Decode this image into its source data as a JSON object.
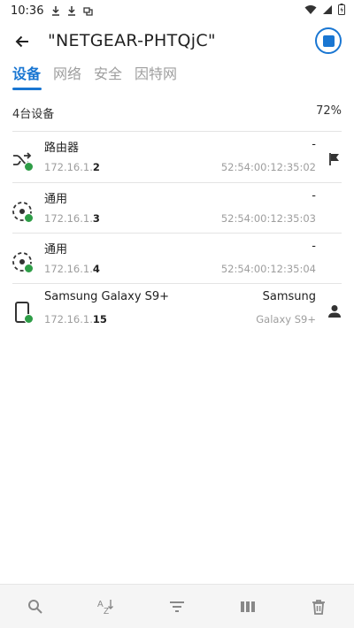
{
  "status_bar": {
    "time": "10:36"
  },
  "app_bar": {
    "title": "\"NETGEAR-PHTQjC\""
  },
  "tabs": [
    {
      "label": "设备",
      "active": true
    },
    {
      "label": "网络",
      "active": false
    },
    {
      "label": "安全",
      "active": false
    },
    {
      "label": "因特网",
      "active": false
    }
  ],
  "summary": {
    "count": "4台设备",
    "percent": "72%"
  },
  "devices": [
    {
      "name": "路由器",
      "ip_prefix": "172.16.1.",
      "ip_suffix": "2",
      "vendor": "-",
      "mac": "52:54:00:12:35:02",
      "icon": "router-shuffle-icon",
      "trailing_icon": "flag-icon"
    },
    {
      "name": "通用",
      "ip_prefix": "172.16.1.",
      "ip_suffix": "3",
      "vendor": "-",
      "mac": "52:54:00:12:35:03",
      "icon": "generic-device-icon",
      "trailing_icon": ""
    },
    {
      "name": "通用",
      "ip_prefix": "172.16.1.",
      "ip_suffix": "4",
      "vendor": "-",
      "mac": "52:54:00:12:35:04",
      "icon": "generic-device-icon",
      "trailing_icon": ""
    },
    {
      "name": "Samsung Galaxy S9+",
      "ip_prefix": "172.16.1.",
      "ip_suffix": "15",
      "vendor": "Samsung",
      "mac": "Galaxy S9+",
      "icon": "phone-icon",
      "trailing_icon": "person-icon"
    }
  ],
  "bottom_bar": [
    "search-icon",
    "sort-az-icon",
    "filter-icon",
    "columns-icon",
    "delete-icon"
  ],
  "colors": {
    "accent": "#1976d2",
    "online": "#2e9d47"
  }
}
